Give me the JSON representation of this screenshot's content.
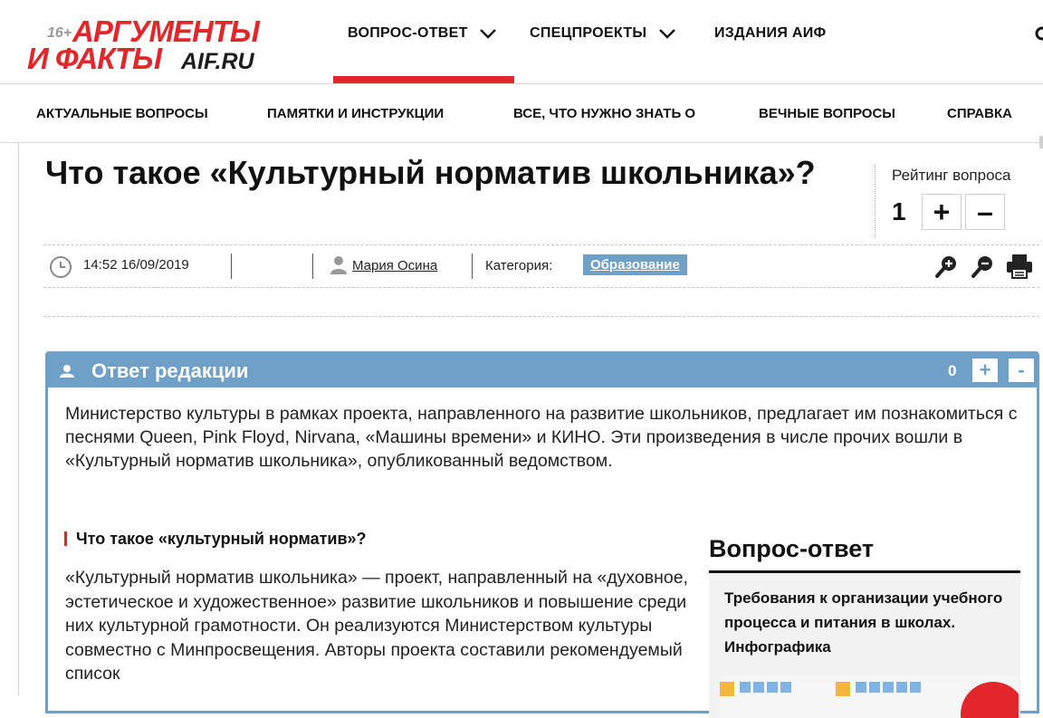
{
  "header": {
    "age_badge": "16+",
    "logo_line1": "АРГУМЕНТЫ",
    "logo_line2": "И ФАКТЫ",
    "logo_site": "AIF.RU",
    "nav": [
      {
        "label": "ВОПРОС-ОТВЕТ",
        "active": true,
        "has_dropdown": true
      },
      {
        "label": "СПЕЦПРОЕКТЫ",
        "active": false,
        "has_dropdown": true
      },
      {
        "label": "ИЗДАНИЯ АИФ",
        "active": false,
        "has_dropdown": false
      }
    ],
    "accent_color": "#e3262a"
  },
  "subnav": [
    "АКТУАЛЬНЫЕ ВОПРОСЫ",
    "ПАМЯТКИ И ИНСТРУКЦИИ",
    "ВСЕ, ЧТО НУЖНО ЗНАТЬ О",
    "ВЕЧНЫЕ ВОПРОСЫ",
    "СПРАВКА"
  ],
  "article": {
    "title": "Что такое «Культурный норматив школьника»?",
    "rating_label": "Рейтинг вопроса",
    "rating_value": "1",
    "rate_plus": "+",
    "rate_minus": "–",
    "datetime": "14:52 16/09/2019",
    "author": "Мария Осина",
    "category_label": "Категория:",
    "category": "Образование",
    "category_color": "#6fa0c8",
    "tools": [
      "zoom-in-icon",
      "zoom-out-icon",
      "print-icon"
    ]
  },
  "answer": {
    "title": "Ответ редакции",
    "count": "0",
    "plus": "+",
    "minus": "-",
    "lead": "Министерство культуры в рамках проекта, направленного на развитие школьников, предлагает им познакомиться с песнями Queen, Pink Floyd, Nirvana, «Машины времени» и КИНО. Эти произведения в числе прочих вошли в «Культурный норматив школьника», опубликованный ведомством.",
    "subheading": "Что такое «культурный норматив»?",
    "paragraph": "«Культурный норматив школьника» — проект, направленный на «духовное, эстетическое и художественное» развитие школьников и повышение среди них культурной грамотности. Он реализуются Министерством культуры совместно с Минпросвещения. Авторы проекта составили рекомендуемый список",
    "box_color": "#6fa0c8"
  },
  "sidebar": {
    "title": "Вопрос-ответ",
    "card_text": "Требования к организации учебного процесса и питания в школах. Инфографика"
  }
}
